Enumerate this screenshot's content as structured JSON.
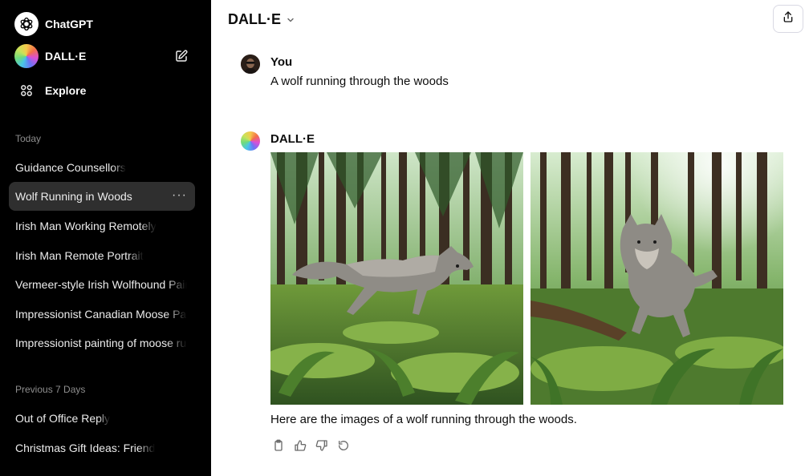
{
  "sidebar": {
    "app_name": "ChatGPT",
    "gpt_name": "DALL·E",
    "explore_label": "Explore",
    "sections": [
      {
        "title": "Today",
        "items": [
          {
            "label": "Guidance Counsellors"
          },
          {
            "label": "Wolf Running in Woods",
            "active": true
          },
          {
            "label": "Irish Man Working Remotely"
          },
          {
            "label": "Irish Man Remote Portrait"
          },
          {
            "label": "Vermeer-style Irish Wolfhound Painting"
          },
          {
            "label": "Impressionist Canadian Moose Painting"
          },
          {
            "label": "Impressionist painting of moose rut"
          }
        ]
      },
      {
        "title": "Previous 7 Days",
        "items": [
          {
            "label": "Out of Office Reply"
          },
          {
            "label": "Christmas Gift Ideas: Friend"
          }
        ]
      }
    ],
    "more_dots": "···"
  },
  "header": {
    "model_name": "DALL·E"
  },
  "conversation": {
    "user": {
      "author": "You",
      "text": "A wolf running through the woods"
    },
    "assistant": {
      "author": "DALL·E",
      "images": [
        {
          "alt": "Wolf running through a forest, side view"
        },
        {
          "alt": "Wolf running toward the viewer through a forest"
        }
      ],
      "text": "Here are the images of a wolf running through the woods."
    }
  },
  "actions": {
    "icons": [
      "copy-icon",
      "thumbs-up-icon",
      "thumbs-down-icon",
      "regenerate-icon"
    ]
  },
  "colors": {
    "sidebar_bg": "#000000",
    "active_item_bg": "#2f2f2f",
    "section_text": "#8e8e8e",
    "main_bg": "#ffffff"
  }
}
